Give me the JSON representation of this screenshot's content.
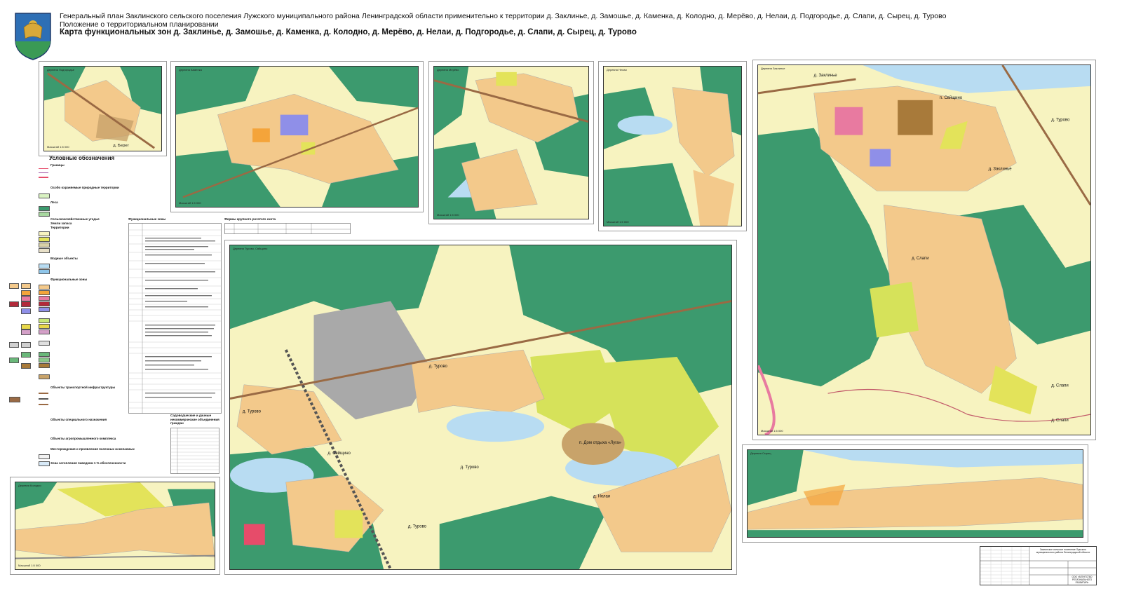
{
  "header": {
    "line1": "Генеральный план Заклинского сельского поселения Лужского муниципального района Ленинградской области применительно к территории д. Заклинье, д. Замошье, д. Каменка, д. Колодно, д. Мерёво, д. Нелаи, д. Подгородье, д. Слапи, д. Сырец, д. Турово",
    "line2": "Положение о территориальном планировании",
    "line3": "Карта функциональных зон д. Заклинье,  д. Замошье, д. Каменка, д. Колодно, д. Мерёво, д. Нелаи, д. Подгородье, д. Слапи, д. Сырец, д. Турово"
  },
  "colors": {
    "residential": "#f3c98b",
    "forest": "#3c9a6e",
    "agri": "#f7f3c0",
    "water": "#b8dcf2",
    "road": "#9a6a44",
    "public": "#e64c6a",
    "yellowgreen": "#e3e35a",
    "gardening": "#c8a36a"
  },
  "maps": {
    "bereg": {
      "title": "Деревня Подгородье",
      "label": "д. Берег",
      "scale": "Масштаб 1:5 000"
    },
    "kamenka": {
      "title": "Деревня Каменка",
      "scale": "Масштаб 1:5 000"
    },
    "merevo": {
      "title": "Деревня Мерёво",
      "scale": "Масштаб 1:5 000"
    },
    "nelai_small": {
      "title": "Деревня Нелаи",
      "scale": "Масштаб 1:5 000"
    },
    "zaklinye": {
      "title": "Деревня Заклинье",
      "labels": [
        "д. Заклинье",
        "п. Свйщино",
        "д. Турово",
        "д. Заклинье",
        "д. Слапи",
        "д. Слапи",
        "д. Слапи"
      ],
      "scale": "Масштаб 1:5 000"
    },
    "turovo": {
      "title": "Деревня Турово, Свйщино",
      "labels": [
        "д. Турово",
        "д. Турово",
        "д. Свйщино",
        "д. Турово",
        "п. Дом отдыха «Луга»",
        "д. Нелаи",
        "д. Турово"
      ],
      "scale": "Масштаб 1:5 000"
    },
    "kolodno": {
      "title": "Деревня Колодно",
      "scale": "Масштаб 1:5 000"
    },
    "syrets": {
      "title": "Деревня Сырец",
      "scale": ""
    }
  },
  "legend": {
    "title": "Условные обозначения",
    "sections": [
      "Границы",
      "Особо охраняемые природные территории",
      "Леса",
      "Сельскохозяйственные угодья",
      "Земли запаса",
      "Территории",
      "Водные объекты",
      "Функциональные зоны",
      "Объекты транспортной инфраструктуры",
      "Объекты специального назначения",
      "Объекты агропромышленного комплекса",
      "Месторождения и проявления полезных ископаемых",
      "Зона затопления паводком 1 % обеспеченности"
    ]
  },
  "tables": {
    "zones_title": "Функциональные зоны",
    "cattle_title": "Фермы крупного рогатого скота",
    "snt_title": "Садоводческие и дачные некоммерческие объединения граждан"
  },
  "stamp": {
    "org": "ООО «АГЕНТСТВО РЕГИОНАЛЬНОГО РАЗВИТИЯ»",
    "project": "Заклинское сельское поселение Лужского муниципального района Ленинградской области"
  }
}
